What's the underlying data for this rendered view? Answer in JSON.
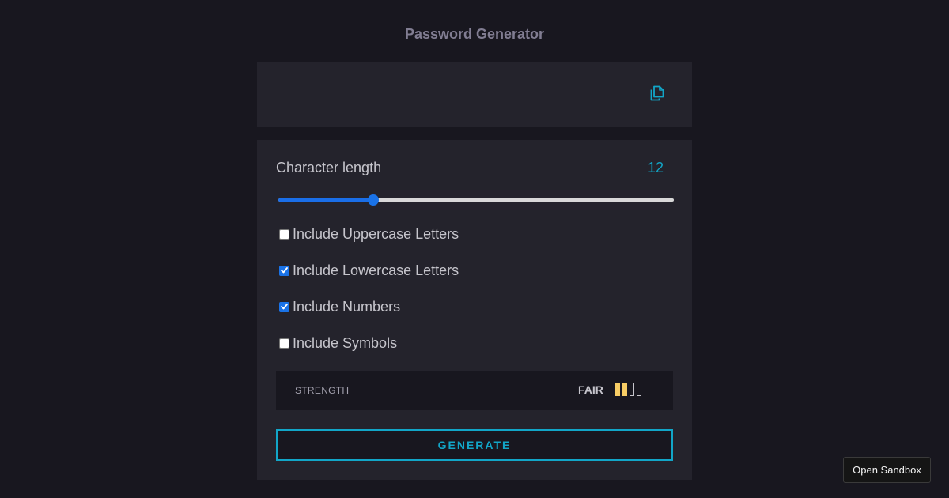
{
  "app": {
    "title": "Password Generator"
  },
  "output": {
    "password": "",
    "copy_icon": "copy-icon"
  },
  "settings": {
    "char_length_label": "Character length",
    "char_length_value": "12",
    "slider": {
      "min": 0,
      "max": 50,
      "value": 12,
      "accent_color": "#1a73e8"
    },
    "options": [
      {
        "label": "Include Uppercase Letters",
        "checked": false
      },
      {
        "label": "Include Lowercase Letters",
        "checked": true
      },
      {
        "label": "Include Numbers",
        "checked": true
      },
      {
        "label": "Include Symbols",
        "checked": false
      }
    ],
    "strength": {
      "label": "STRENGTH",
      "value": "FAIR",
      "filled_bars": 2,
      "total_bars": 4,
      "bar_color": "#f8cd65"
    },
    "generate_label": "GENERATE"
  },
  "sandbox": {
    "label": "Open Sandbox"
  },
  "colors": {
    "background": "#18171f",
    "panel": "#24232c",
    "accent": "#12a6c8"
  }
}
